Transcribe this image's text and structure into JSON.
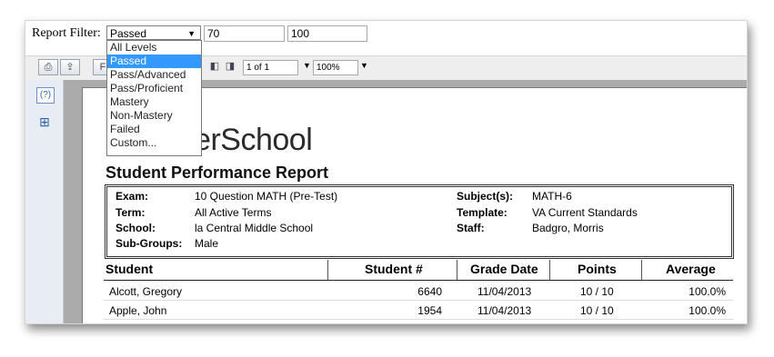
{
  "filter": {
    "label": "Report Filter:",
    "selected": "Passed",
    "min_value": "70",
    "max_value": "100",
    "options": [
      "All Levels",
      "Passed",
      "Pass/Advanced",
      "Pass/Proficient",
      "Mastery",
      "Non-Mastery",
      "Failed",
      "Custom..."
    ]
  },
  "toolbar": {
    "page_indicator": "1 of 1",
    "zoom": "100%"
  },
  "report": {
    "logo_text": "werSchool",
    "title": "Student Performance Report",
    "info": {
      "exam_label": "Exam:",
      "exam": "10 Question MATH (Pre-Test)",
      "term_label": "Term:",
      "term": "All Active Terms",
      "school_label": "School:",
      "school": "la Central Middle School",
      "subgroups_label": "Sub-Groups:",
      "subgroups": "Male",
      "subjects_label": "Subject(s):",
      "subjects": "MATH-6",
      "template_label": "Template:",
      "template": "VA Current Standards",
      "staff_label": "Staff:",
      "staff": "Badgro, Morris"
    },
    "columns": [
      "Student",
      "Student #",
      "Grade Date",
      "Points",
      "Average"
    ],
    "rows": [
      [
        "Alcott, Gregory",
        "6640",
        "11/04/2013",
        "10 / 10",
        "100.0%"
      ],
      [
        "Apple, John",
        "1954",
        "11/04/2013",
        "10 / 10",
        "100.0%"
      ]
    ]
  }
}
